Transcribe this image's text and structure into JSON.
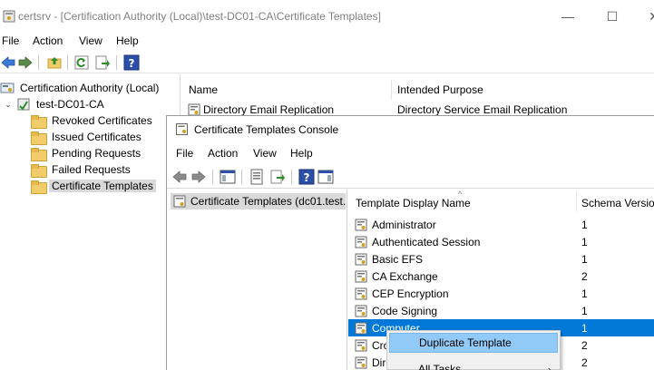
{
  "window": {
    "title": "certsrv - [Certification Authority (Local)\\test-DC01-CA\\Certificate Templates]",
    "minimize": "—",
    "maximize": "☐",
    "close": "✕"
  },
  "menu": [
    "File",
    "Action",
    "View",
    "Help"
  ],
  "tree": {
    "root": "Certification Authority (Local)",
    "ca": "test-DC01-CA",
    "items": [
      "Revoked Certificates",
      "Issued Certificates",
      "Pending Requests",
      "Failed Requests",
      "Certificate Templates"
    ],
    "selected_index": 4
  },
  "outer_list": {
    "columns": [
      "Name",
      "Intended Purpose"
    ],
    "rows": [
      {
        "name": "Directory Email Replication",
        "purpose": "Directory Service Email Replication"
      }
    ]
  },
  "console": {
    "title": "Certificate Templates Console",
    "menu": [
      "File",
      "Action",
      "View",
      "Help"
    ],
    "tree_item": "Certificate Templates (dc01.test.",
    "columns": [
      "Template Display Name",
      "Schema Version"
    ],
    "sort_arrow": "^",
    "rows": [
      {
        "name": "Administrator",
        "ver": "1"
      },
      {
        "name": "Authenticated Session",
        "ver": "1"
      },
      {
        "name": "Basic EFS",
        "ver": "1"
      },
      {
        "name": "CA Exchange",
        "ver": "2"
      },
      {
        "name": "CEP Encryption",
        "ver": "1"
      },
      {
        "name": "Code Signing",
        "ver": "1"
      },
      {
        "name": "Computer",
        "ver": "1"
      },
      {
        "name": "Cro",
        "ver": "2"
      },
      {
        "name": "Dire",
        "ver": "2"
      }
    ],
    "selected_index": 6
  },
  "context_menu": {
    "items": [
      "Duplicate Template",
      "All Tasks"
    ],
    "submenu_arrow": "›"
  },
  "colors": {
    "selection": "#0078d7",
    "menu_hover": "#91c9f7",
    "tree_selected": "#d9d9d9"
  }
}
